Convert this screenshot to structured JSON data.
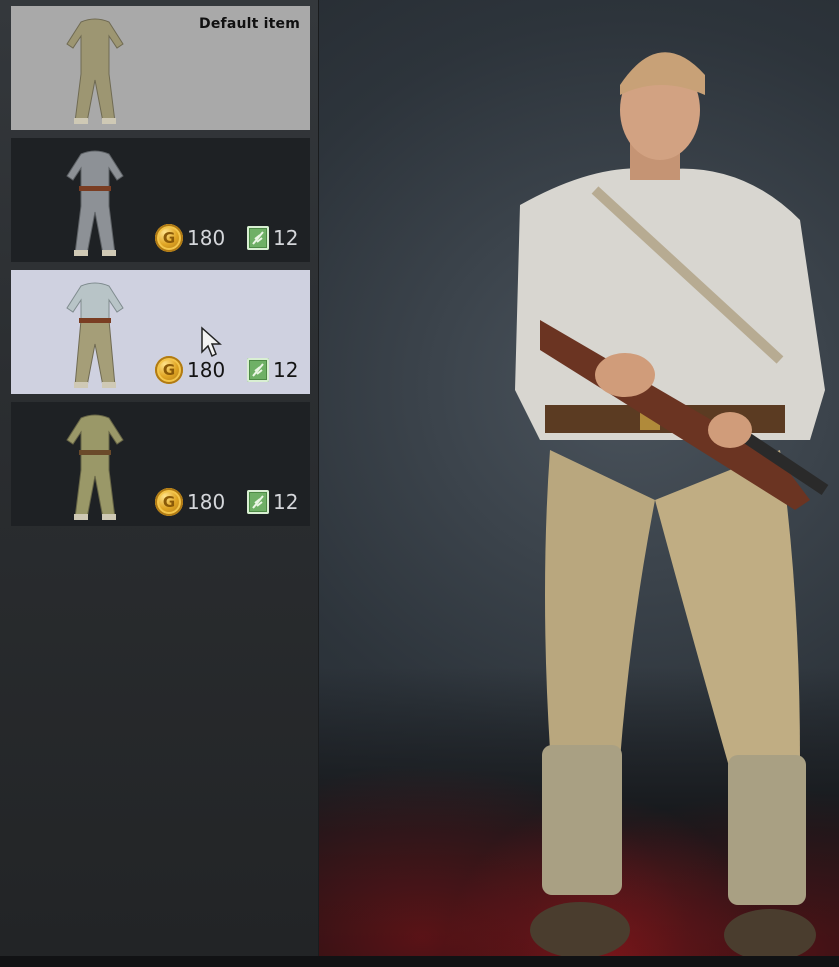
{
  "items": [
    {
      "id": "uniform-default",
      "default_label": "Default item",
      "state": "default"
    },
    {
      "id": "uniform-grey",
      "state": "normal",
      "gold_price": "180",
      "ticket_price": "12"
    },
    {
      "id": "uniform-light",
      "state": "hover",
      "gold_price": "180",
      "ticket_price": "12"
    },
    {
      "id": "uniform-olive",
      "state": "normal",
      "gold_price": "180",
      "ticket_price": "12"
    }
  ],
  "icons": {
    "gold": "gold-coin-icon",
    "ticket": "green-ticket-icon",
    "coin_glyph": "G"
  },
  "colors": {
    "default_card": "#a9a9a9",
    "hover_card": "#cfd1e0",
    "normal_card": "#1e2124",
    "gold": "#e0a524",
    "ticket": "#6fb066"
  }
}
